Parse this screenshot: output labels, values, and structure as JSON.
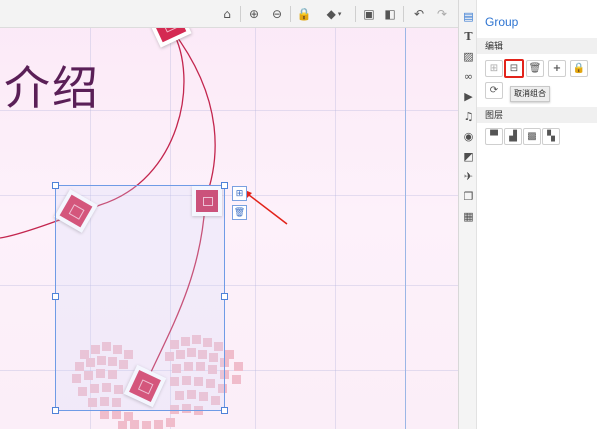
{
  "toolbar": {
    "buttons": [
      "home-icon",
      "zoom-in-icon",
      "zoom-out-icon",
      "lock-icon",
      "fill-icon",
      "bring-forward-icon",
      "send-backward-icon",
      "undo-icon",
      "redo-icon"
    ]
  },
  "canvas": {
    "title_text": "介绍"
  },
  "icon_strip": {
    "items": [
      "group-icon",
      "text-icon",
      "image-icon",
      "link-icon",
      "video-icon",
      "music-icon",
      "compass-icon",
      "shapes-icon",
      "airplane-icon",
      "layers-icon",
      "template-icon"
    ]
  },
  "panel": {
    "title": "Group",
    "edit_section": "编辑",
    "layer_section": "图层",
    "tooltip": "取消组合"
  },
  "colors": {
    "accent": "#2e74d1",
    "highlight": "#e2231a",
    "canvas_bg": "#fbe9f7",
    "curve": "#c3264e"
  }
}
